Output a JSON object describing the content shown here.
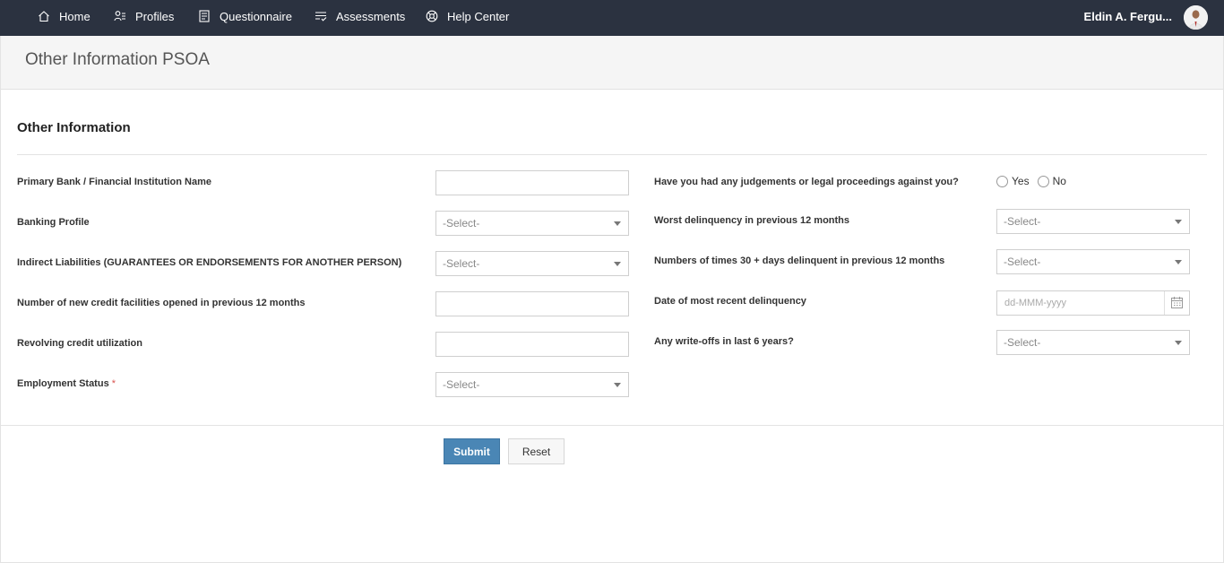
{
  "nav": {
    "items": [
      {
        "label": "Home",
        "icon": "home-icon"
      },
      {
        "label": "Profiles",
        "icon": "profiles-icon"
      },
      {
        "label": "Questionnaire",
        "icon": "questionnaire-icon"
      },
      {
        "label": "Assessments",
        "icon": "assessments-icon"
      },
      {
        "label": "Help Center",
        "icon": "help-center-icon"
      }
    ],
    "user_name": "Eldin A. Fergu..."
  },
  "page": {
    "title": "Other Information PSOA",
    "section_title": "Other Information"
  },
  "form": {
    "left": [
      {
        "label": "Primary Bank / Financial Institution Name",
        "type": "text",
        "value": ""
      },
      {
        "label": "Banking Profile",
        "type": "select",
        "value": "-Select-"
      },
      {
        "label": "Indirect Liabilities (GUARANTEES OR ENDORSEMENTS FOR ANOTHER PERSON)",
        "type": "select",
        "value": "-Select-"
      },
      {
        "label": "Number of new credit facilities opened in previous 12 months",
        "type": "text",
        "value": ""
      },
      {
        "label": "Revolving credit utilization",
        "type": "text",
        "value": ""
      },
      {
        "label": "Employment Status",
        "required_mark": "*",
        "type": "select",
        "value": "-Select-"
      }
    ],
    "right": [
      {
        "label": "Have you had any judgements or legal proceedings against you?",
        "type": "radio",
        "options": [
          "Yes",
          "No"
        ]
      },
      {
        "label": "Worst delinquency in previous 12 months",
        "type": "select",
        "value": "-Select-"
      },
      {
        "label": "Numbers of times 30 + days delinquent in previous 12 months",
        "type": "select",
        "value": "-Select-"
      },
      {
        "label": "Date of most recent delinquency",
        "type": "date",
        "placeholder": "dd-MMM-yyyy"
      },
      {
        "label": "Any write-offs in last 6 years?",
        "type": "select",
        "value": "-Select-"
      }
    ]
  },
  "actions": {
    "submit_label": "Submit",
    "reset_label": "Reset"
  },
  "colors": {
    "nav_bg": "#2b3240",
    "primary": "#4a86b5",
    "required": "#d9534f"
  }
}
